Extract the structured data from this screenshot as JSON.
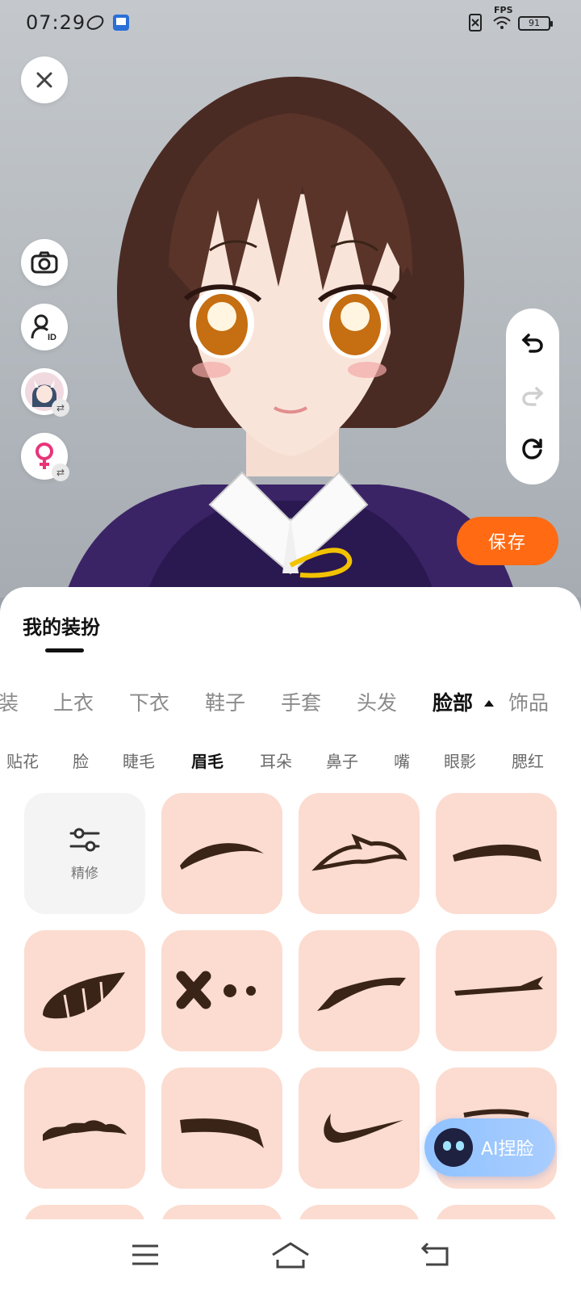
{
  "status_bar": {
    "time": "07:29",
    "fps_label": "FPS",
    "battery": "91"
  },
  "actions": {
    "save_label": "保存",
    "ai_label": "AI捏脸"
  },
  "panel": {
    "title": "我的装扮",
    "categories": [
      "装",
      "上衣",
      "下衣",
      "鞋子",
      "手套",
      "头发",
      "脸部",
      "饰品"
    ],
    "active_category": "脸部",
    "subcategories": [
      "贴花",
      "脸",
      "睫毛",
      "眉毛",
      "耳朵",
      "鼻子",
      "嘴",
      "眼影",
      "腮红"
    ],
    "active_subcategory": "眉毛",
    "refine_label": "精修"
  },
  "colors": {
    "accent_orange": "#ff6a13",
    "tile_bg": "#fcdcd0",
    "brow_color": "#3a2418",
    "hoodie_purple": "#3b2466",
    "hair_brown": "#4a2b23"
  }
}
